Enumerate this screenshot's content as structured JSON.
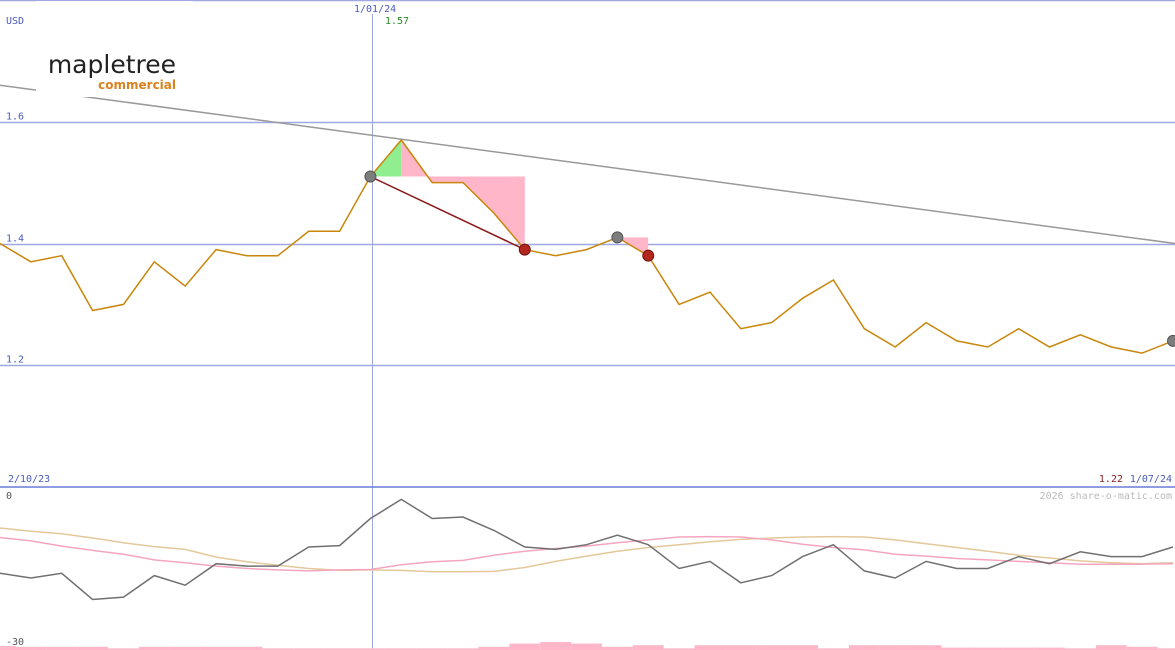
{
  "currency": "USD",
  "logo": {
    "name": "mapletree",
    "sub": "commercial"
  },
  "credit": "2026 share-o-matic.com",
  "marker": {
    "date_label": "1/01/24",
    "value_label": "1.57"
  },
  "range": {
    "start_label": "2/10/23",
    "end_label": "1/07/24",
    "last_value_label": "1.22"
  },
  "colors": {
    "price": "#c8860a",
    "trend": "#999999",
    "grid": "#9fa8e0",
    "panel_border": "#6b7bd8",
    "gain_fill": "#90ee90",
    "loss_fill": "#ffb6c8",
    "trade_line": "#8b1a1a",
    "osc_main": "#707070",
    "osc_pink": "#f4a6c0",
    "osc_tan": "#e3c89a"
  },
  "chart_data": [
    {
      "type": "line",
      "ylabel": "USD",
      "ylim": [
        1.0,
        1.8
      ],
      "yticks": [
        "1.2",
        "1.4",
        "1.6",
        "1.8"
      ],
      "series": [
        {
          "values": [
            1.4,
            1.37,
            1.38,
            1.29,
            1.3,
            1.37,
            1.33,
            1.39,
            1.38,
            1.38,
            1.42,
            1.42,
            1.51,
            1.57,
            1.5,
            1.5,
            1.45,
            1.39,
            1.38,
            1.39,
            1.41,
            1.38,
            1.3,
            1.32,
            1.26,
            1.27,
            1.31,
            1.34,
            1.26,
            1.23,
            1.27,
            1.24,
            1.23,
            1.26,
            1.23,
            1.25,
            1.23,
            1.22,
            1.24
          ]
        },
        {
          "start": 1.66,
          "end": 1.4
        }
      ],
      "trade": {
        "entry_index": 12,
        "entry_value": 1.51,
        "exit_index": 17,
        "exit_value": 1.39
      },
      "points": [
        {
          "index": 12,
          "value": 1.51,
          "kind": "grey"
        },
        {
          "index": 17,
          "value": 1.39,
          "kind": "red"
        },
        {
          "index": 20,
          "value": 1.41,
          "kind": "grey"
        },
        {
          "index": 21,
          "value": 1.38,
          "kind": "red"
        },
        {
          "index": 38,
          "value": 1.24,
          "kind": "grey"
        }
      ],
      "shading": [
        {
          "kind": "gain",
          "from_index": 12,
          "to_index": 13,
          "base": 1.51
        },
        {
          "kind": "loss",
          "from_index": 13,
          "to_index": 17,
          "base": 1.51
        },
        {
          "kind": "loss",
          "from_index": 20,
          "to_index": 21,
          "base": 1.41
        }
      ]
    },
    {
      "type": "line",
      "ylim": [
        -30,
        0
      ],
      "yticks": [
        "0",
        "-30"
      ],
      "series": [
        {
          "values": [
            -16,
            -17,
            -16,
            -21.5,
            -21,
            -16.5,
            -18.5,
            -14,
            -14.5,
            -14.5,
            -10.5,
            -10.2,
            -4.5,
            -0.5,
            -4.5,
            -4.2,
            -7,
            -10.5,
            -11,
            -10,
            -8,
            -10,
            -15,
            -13.5,
            -18,
            -16.5,
            -12.5,
            -10,
            -15.5,
            -17,
            -13.5,
            -15,
            -15,
            -12.5,
            -14,
            -11.5,
            -12.5,
            -12.5,
            -10.5
          ]
        },
        {
          "values": [
            -8.5,
            -9.2,
            -10.3,
            -11.2,
            -12,
            -13.2,
            -13.8,
            -14.5,
            -15,
            -15.3,
            -15.5,
            -15.3,
            -15.2,
            -14.2,
            -13.6,
            -13.3,
            -12.2,
            -11.4,
            -10.8,
            -10.3,
            -9.6,
            -9,
            -8.4,
            -8.3,
            -8.4,
            -9,
            -9.9,
            -10.6,
            -11.1,
            -12,
            -12.4,
            -12.9,
            -13.2,
            -13.5,
            -13.8,
            -14.1,
            -14.1,
            -14.1,
            -14.0
          ]
        },
        {
          "values": [
            -6.5,
            -7.2,
            -7.7,
            -8.6,
            -9.6,
            -10.4,
            -11,
            -12.6,
            -13.6,
            -14.3,
            -15,
            -15.4,
            -15.3,
            -15.4,
            -15.7,
            -15.7,
            -15.6,
            -14.8,
            -13.5,
            -12.4,
            -11.4,
            -10.6,
            -10,
            -9.4,
            -8.9,
            -8.6,
            -8.4,
            -8.3,
            -8.4,
            -9.0,
            -9.8,
            -10.6,
            -11.4,
            -12.2,
            -12.8,
            -13.4,
            -13.8,
            -14.0,
            -13.8
          ]
        }
      ],
      "bars": [
        0.5,
        0.4,
        0.4,
        0.4,
        0.2,
        0.4,
        0.4,
        0.4,
        0.4,
        0.2,
        0.2,
        0.2,
        0.2,
        0.2,
        0.2,
        0.2,
        0.4,
        0.8,
        1.0,
        0.8,
        0.4,
        0.6,
        0.2,
        0.6,
        0.6,
        0.6,
        0.6,
        0.2,
        0.6,
        0.6,
        0.6,
        0.3,
        0.3,
        0.3,
        0.3,
        0.2,
        0.6,
        0.4,
        0.2
      ]
    }
  ]
}
